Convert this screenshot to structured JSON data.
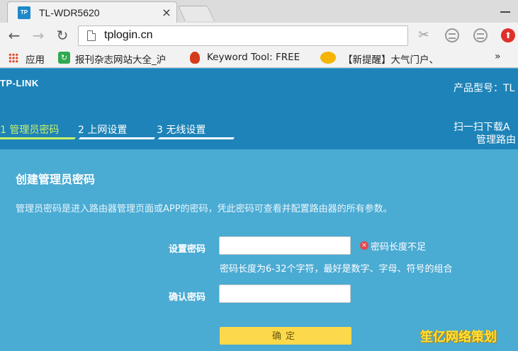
{
  "browser": {
    "tab_title": "TL-WDR5620",
    "tab_favicon_text": "TP",
    "close_glyph": "×",
    "url": "tplogin.cn",
    "back_glyph": "←",
    "forward_glyph": "→",
    "reload_glyph": "↻",
    "bookmarks": [
      {
        "label": "应用",
        "icon": "apps-grid-icon"
      },
      {
        "label": "报刊杂志网站大全_沪",
        "icon": "green-refresh-icon"
      },
      {
        "label": "Keyword Tool: FREE",
        "icon": "fire-icon"
      },
      {
        "label": "【新提醒】大气门户、",
        "icon": "duck-icon"
      }
    ],
    "more_glyph": "»"
  },
  "router": {
    "logo": "TP-LINK",
    "model_label": "产品型号：TL",
    "steps": [
      {
        "label": "1 管理员密码",
        "active": true
      },
      {
        "label": "2 上网设置",
        "active": false
      },
      {
        "label": "3 无线设置",
        "active": false
      }
    ],
    "scan_lines": [
      "扫一扫下载A",
      "管理路由",
      "。"
    ]
  },
  "form": {
    "title": "创建管理员密码",
    "description": "管理员密码是进入路由器管理页面或APP的密码，凭此密码可查看并配置路由器的所有参数。",
    "password_label": "设置密码",
    "password_value": "",
    "error_glyph": "×",
    "error_text": "密码长度不足",
    "hint_text": "密码长度为6-32个字符，最好是数字、字母、符号的组合",
    "confirm_label": "确认密码",
    "confirm_value": "",
    "ok_label": "确定"
  },
  "watermark": "笙亿网络策划",
  "colors": {
    "header_bg": "#1d83b8",
    "content_bg": "#4aabd3",
    "active_step": "#c9f06a",
    "ok_button": "#fcd94a"
  }
}
